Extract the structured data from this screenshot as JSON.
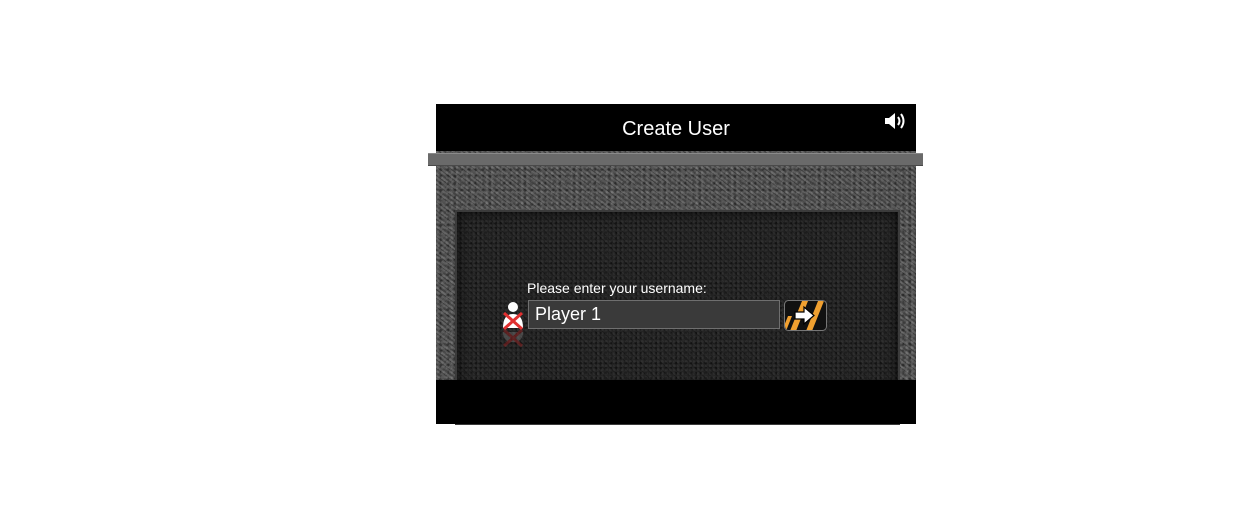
{
  "window": {
    "title": "Create User"
  },
  "form": {
    "prompt": "Please enter your username:",
    "username_value": "Player 1"
  },
  "icons": {
    "sound": "speaker-icon",
    "user": "user-remove-icon",
    "submit": "arrow-right-icon"
  },
  "colors": {
    "background": "#000000",
    "title_text": "#ffffff",
    "panel": "#1e1e1e",
    "button_stripe": "#f0a030",
    "remove_x": "#e03030"
  }
}
